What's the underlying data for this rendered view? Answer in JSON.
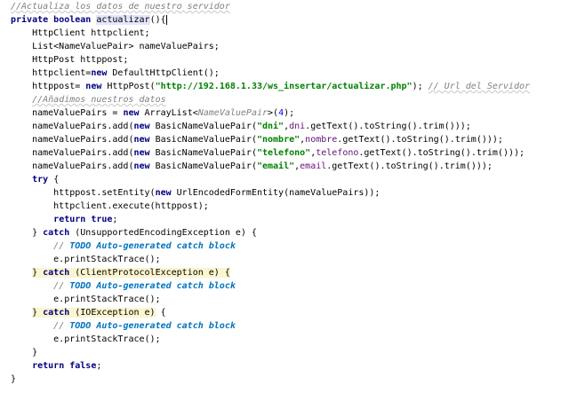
{
  "lines": [
    [
      {
        "t": "//Actualiza los datos de nuestro servidor",
        "c": "comment squiggle"
      }
    ],
    [
      {
        "t": "private ",
        "c": "keyword"
      },
      {
        "t": "boolean ",
        "c": "keyword"
      },
      {
        "t": "actualizar",
        "c": "hl-word"
      },
      {
        "t": "(){",
        "c": "caret"
      }
    ],
    [
      {
        "t": "    HttpClient httpclient;"
      }
    ],
    [
      {
        "t": "    List<NameValuePair> nameValuePairs;"
      }
    ],
    [
      {
        "t": "    HttpPost httppost;"
      }
    ],
    [
      {
        "t": "    httpclient="
      },
      {
        "t": "new ",
        "c": "keyword"
      },
      {
        "t": "DefaultHttpClient();"
      }
    ],
    [
      {
        "t": "    httppost= "
      },
      {
        "t": "new ",
        "c": "keyword"
      },
      {
        "t": "HttpPost("
      },
      {
        "t": "\"http://192.168.1.33/ws_insertar/actualizar.php\"",
        "c": "string"
      },
      {
        "t": "); "
      },
      {
        "t": "// Url del Servidor",
        "c": "comment squiggle"
      }
    ],
    [
      {
        "t": "    "
      },
      {
        "t": "//Añadimos nuestros datos",
        "c": "comment squiggle"
      }
    ],
    [
      {
        "t": "    nameValuePairs = "
      },
      {
        "t": "new ",
        "c": "keyword"
      },
      {
        "t": "ArrayList<"
      },
      {
        "t": "NameValuePair",
        "c": "comment"
      },
      {
        "t": ">("
      },
      {
        "t": "4",
        "c": "number"
      },
      {
        "t": ");"
      }
    ],
    [
      {
        "t": "    nameValuePairs.add("
      },
      {
        "t": "new ",
        "c": "keyword"
      },
      {
        "t": "BasicNameValuePair("
      },
      {
        "t": "\"dni\"",
        "c": "string"
      },
      {
        "t": ","
      },
      {
        "t": "dni",
        "c": "field"
      },
      {
        "t": ".getText().toString().trim()));"
      }
    ],
    [
      {
        "t": "    nameValuePairs.add("
      },
      {
        "t": "new ",
        "c": "keyword"
      },
      {
        "t": "BasicNameValuePair("
      },
      {
        "t": "\"nombre\"",
        "c": "string"
      },
      {
        "t": ","
      },
      {
        "t": "nombre",
        "c": "field"
      },
      {
        "t": ".getText().toString().trim()));"
      }
    ],
    [
      {
        "t": "    nameValuePairs.add("
      },
      {
        "t": "new ",
        "c": "keyword"
      },
      {
        "t": "BasicNameValuePair("
      },
      {
        "t": "\"telefono\"",
        "c": "string"
      },
      {
        "t": ","
      },
      {
        "t": "telefono",
        "c": "field"
      },
      {
        "t": ".getText().toString().trim()));"
      }
    ],
    [
      {
        "t": "    nameValuePairs.add("
      },
      {
        "t": "new ",
        "c": "keyword"
      },
      {
        "t": "BasicNameValuePair("
      },
      {
        "t": "\"email\"",
        "c": "string"
      },
      {
        "t": ","
      },
      {
        "t": "email",
        "c": "field"
      },
      {
        "t": ".getText().toString().trim()));"
      }
    ],
    [
      {
        "t": "    "
      },
      {
        "t": "try ",
        "c": "keyword"
      },
      {
        "t": "{"
      }
    ],
    [
      {
        "t": "        httppost.setEntity("
      },
      {
        "t": "new ",
        "c": "keyword"
      },
      {
        "t": "UrlEncodedFormEntity(nameValuePairs));"
      }
    ],
    [
      {
        "t": "        httpclient.execute(httppost);"
      }
    ],
    [
      {
        "t": "        "
      },
      {
        "t": "return ",
        "c": "keyword"
      },
      {
        "t": "true",
        "c": "keyword"
      },
      {
        "t": ";"
      }
    ],
    [
      {
        "t": "    } "
      },
      {
        "t": "catch ",
        "c": "keyword"
      },
      {
        "t": "(UnsupportedEncodingException e) {"
      }
    ],
    [
      {
        "t": "        "
      },
      {
        "t": "// ",
        "c": "comment"
      },
      {
        "t": "TODO Auto-generated catch block",
        "c": "todo"
      }
    ],
    [
      {
        "t": "        e.printStackTrace();"
      }
    ],
    [
      {
        "t": "    "
      },
      {
        "t": "} ",
        "c": "hl"
      },
      {
        "t": "catch ",
        "c": "keyword hl"
      },
      {
        "t": "(ClientProtocolException e) {",
        "c": "hl"
      }
    ],
    [
      {
        "t": "        "
      },
      {
        "t": "// ",
        "c": "comment"
      },
      {
        "t": "TODO Auto-generated catch block",
        "c": "todo"
      }
    ],
    [
      {
        "t": "        e.printStackTrace();"
      }
    ],
    [
      {
        "t": "    "
      },
      {
        "t": "} ",
        "c": "hl"
      },
      {
        "t": "catch ",
        "c": "keyword hl"
      },
      {
        "t": "(IOException e)",
        "c": "hl"
      },
      {
        "t": " {"
      }
    ],
    [
      {
        "t": "        "
      },
      {
        "t": "// ",
        "c": "comment"
      },
      {
        "t": "TODO Auto-generated catch block",
        "c": "todo"
      }
    ],
    [
      {
        "t": "        e.printStackTrace();"
      }
    ],
    [
      {
        "t": "    }"
      }
    ],
    [
      {
        "t": "    "
      },
      {
        "t": "return ",
        "c": "keyword"
      },
      {
        "t": "false",
        "c": "keyword"
      },
      {
        "t": ";"
      }
    ],
    [
      {
        "t": "}"
      }
    ]
  ]
}
